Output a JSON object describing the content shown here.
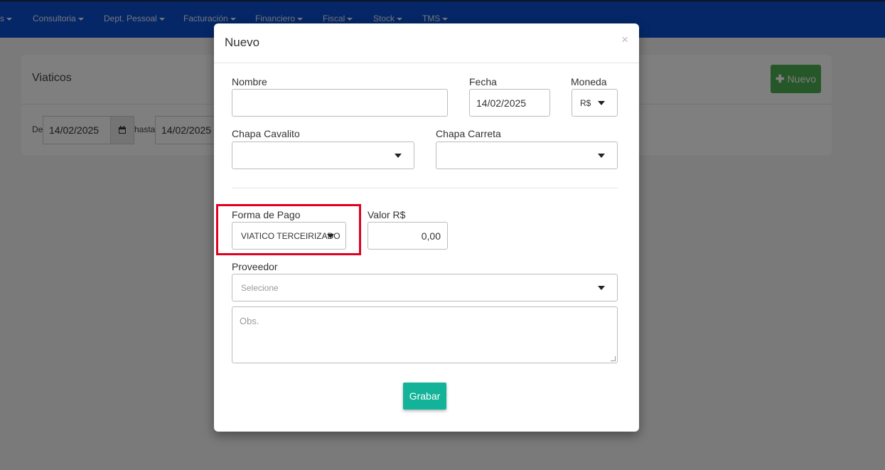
{
  "navbar": {
    "items": [
      {
        "label": "s"
      },
      {
        "label": "Consultoria"
      },
      {
        "label": "Dept. Pessoal"
      },
      {
        "label": "Facturación"
      },
      {
        "label": "Financiero"
      },
      {
        "label": "Fiscal"
      },
      {
        "label": "Stock"
      },
      {
        "label": "TMS"
      }
    ]
  },
  "page": {
    "title": "Viaticos",
    "new_button_label": "Nuevo",
    "filter": {
      "from_label": "De",
      "from_value": "14/02/2025",
      "to_label": "hasta",
      "to_value": "14/02/2025"
    }
  },
  "modal": {
    "title": "Nuevo",
    "close_label": "×",
    "fields": {
      "nombre": {
        "label": "Nombre",
        "value": ""
      },
      "fecha": {
        "label": "Fecha",
        "value": "14/02/2025"
      },
      "moneda": {
        "label": "Moneda",
        "value": "R$"
      },
      "chapa_cavalito": {
        "label": "Chapa Cavalito",
        "value": ""
      },
      "chapa_carreta": {
        "label": "Chapa Carreta",
        "value": ""
      },
      "forma_pago": {
        "label": "Forma de Pago",
        "value": "VIATICO TERCEIRIZADO"
      },
      "valor": {
        "label": "Valor R$",
        "value": "0,00"
      },
      "proveedor": {
        "label": "Proveedor",
        "placeholder": "Selecione"
      },
      "obs": {
        "placeholder": "Obs."
      }
    },
    "save_label": "Grabar"
  },
  "colors": {
    "navbar": "#0a4fd0",
    "new_button": "#4caf50",
    "save_button": "#12b398",
    "highlight": "#e00022"
  }
}
